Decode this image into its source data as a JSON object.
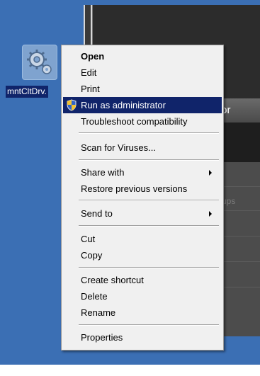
{
  "desktop_icon": {
    "label": "mntCltDrv.",
    "icon": "gear-program-icon"
  },
  "background_window": {
    "title_fragment": "tor",
    "faded_text": "ups"
  },
  "context_menu": {
    "items": [
      {
        "label": "Open",
        "bold": true
      },
      {
        "label": "Edit"
      },
      {
        "label": "Print"
      },
      {
        "label": "Run as administrator",
        "icon": "uac-shield-icon",
        "highlighted": true
      },
      {
        "label": "Troubleshoot compatibility"
      },
      {
        "label": "Scan for Viruses..."
      },
      {
        "label": "Share with",
        "submenu": true
      },
      {
        "label": "Restore previous versions"
      },
      {
        "label": "Send to",
        "submenu": true
      },
      {
        "label": "Cut"
      },
      {
        "label": "Copy"
      },
      {
        "label": "Create shortcut"
      },
      {
        "label": "Delete"
      },
      {
        "label": "Rename"
      },
      {
        "label": "Properties"
      }
    ]
  },
  "colors": {
    "desktop": "#3b6fb4",
    "highlight": "#10246a",
    "menu_bg": "#f0f0f0"
  }
}
